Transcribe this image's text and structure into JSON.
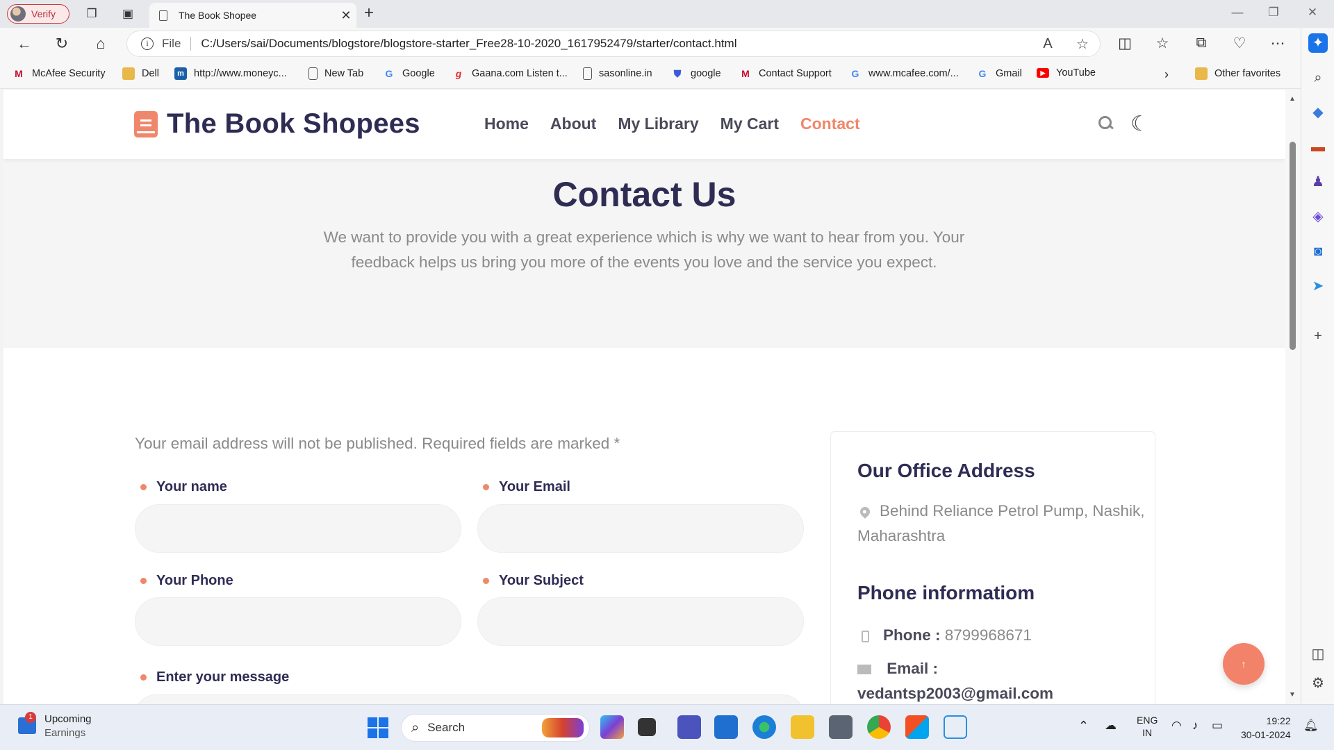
{
  "browser": {
    "verify_label": "Verify",
    "tab_title": "The Book Shopee",
    "url_scheme": "File",
    "url": "C:/Users/sai/Documents/blogstore/blogstore-starter_Free28-10-2020_1617952479/starter/contact.html",
    "favorites": [
      {
        "label": "McAfee Security",
        "icon": "mcafee-icon",
        "color": "#c8102e"
      },
      {
        "label": "Dell",
        "icon": "folder-icon",
        "color": "#e8b84a"
      },
      {
        "label": "http://www.moneyc...",
        "icon": "moneycontrol-icon",
        "color": "#1a5fa8"
      },
      {
        "label": "New Tab",
        "icon": "page-icon",
        "color": "#555555"
      },
      {
        "label": "Google",
        "icon": "google-icon",
        "color": "#4285f4"
      },
      {
        "label": "Gaana.com Listen t...",
        "icon": "gaana-icon",
        "color": "#e72c30"
      },
      {
        "label": "sasonline.in",
        "icon": "page-icon",
        "color": "#555555"
      },
      {
        "label": "google",
        "icon": "shield-icon",
        "color": "#3b5bdb"
      },
      {
        "label": "Contact Support",
        "icon": "mcafee-icon",
        "color": "#c8102e"
      },
      {
        "label": "www.mcafee.com/...",
        "icon": "google-icon",
        "color": "#4285f4"
      },
      {
        "label": "Gmail",
        "icon": "google-icon",
        "color": "#4285f4"
      },
      {
        "label": "YouTube",
        "icon": "youtube-icon",
        "color": "#ff0000"
      }
    ],
    "other_favorites": "Other favorites"
  },
  "site": {
    "brand": "The Book Shopees",
    "nav": [
      {
        "label": "Home",
        "active": false
      },
      {
        "label": "About",
        "active": false
      },
      {
        "label": "My Library",
        "active": false
      },
      {
        "label": "My Cart",
        "active": false
      },
      {
        "label": "Contact",
        "active": true
      }
    ],
    "accent_color": "#f0876b",
    "heading_color": "#2f2c54"
  },
  "hero": {
    "title": "Contact Us",
    "text": "We want to provide you with a great experience which is why we want to hear from you. Your feedback helps us bring you more of the events you love and the service you expect."
  },
  "form": {
    "notice": "Your email address will not be published. Required fields are marked *",
    "name_label": "Your name",
    "email_label": "Your Email",
    "phone_label": "Your Phone",
    "subject_label": "Your Subject",
    "message_label": "Enter your message"
  },
  "office": {
    "address_title": "Our Office Address",
    "address": "Behind Reliance Petrol Pump, Nashik, Maharashtra",
    "phone_title": "Phone informatiom",
    "phone_label": "Phone :",
    "phone_value": "8799968671",
    "email_label": "Email :",
    "email_value": "vedantsp2003@gmail.com"
  },
  "taskbar": {
    "widget_badge": "1",
    "widget_title": "Upcoming",
    "widget_sub": "Earnings",
    "search_label": "Search",
    "lang_1": "ENG",
    "lang_2": "IN",
    "time": "19:22",
    "date": "30-01-2024"
  }
}
